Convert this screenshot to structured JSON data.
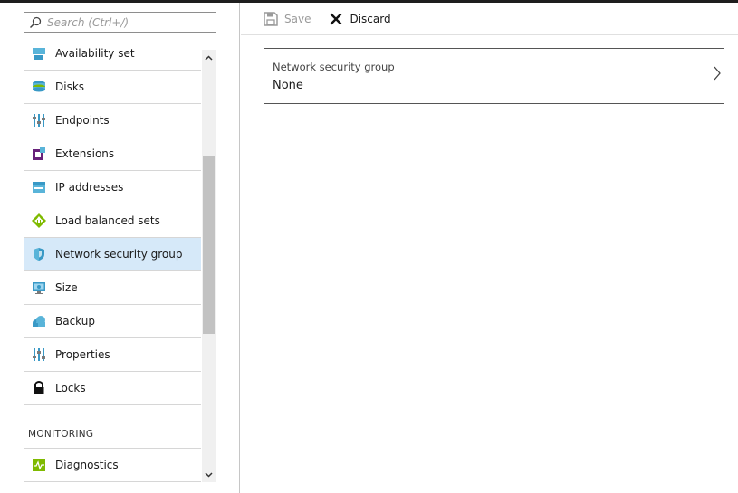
{
  "search": {
    "placeholder": "Search (Ctrl+/)"
  },
  "sidebar": {
    "items": [
      {
        "label": "Availability set",
        "icon": "availability-set-icon"
      },
      {
        "label": "Disks",
        "icon": "disks-icon"
      },
      {
        "label": "Endpoints",
        "icon": "endpoints-icon"
      },
      {
        "label": "Extensions",
        "icon": "extensions-icon"
      },
      {
        "label": "IP addresses",
        "icon": "ip-addresses-icon"
      },
      {
        "label": "Load balanced sets",
        "icon": "load-balancer-icon"
      },
      {
        "label": "Network security group",
        "icon": "shield-icon",
        "selected": true
      },
      {
        "label": "Size",
        "icon": "monitor-icon"
      },
      {
        "label": "Backup",
        "icon": "cloud-backup-icon"
      },
      {
        "label": "Properties",
        "icon": "properties-icon"
      },
      {
        "label": "Locks",
        "icon": "lock-icon"
      }
    ],
    "section_header": "MONITORING",
    "monitoring_items": [
      {
        "label": "Diagnostics",
        "icon": "diagnostics-icon"
      }
    ]
  },
  "toolbar": {
    "save_label": "Save",
    "discard_label": "Discard"
  },
  "setting": {
    "label": "Network security group",
    "value": "None"
  },
  "colors": {
    "selected_bg": "#d6e9f9",
    "accent_blue": "#2b88d8"
  }
}
